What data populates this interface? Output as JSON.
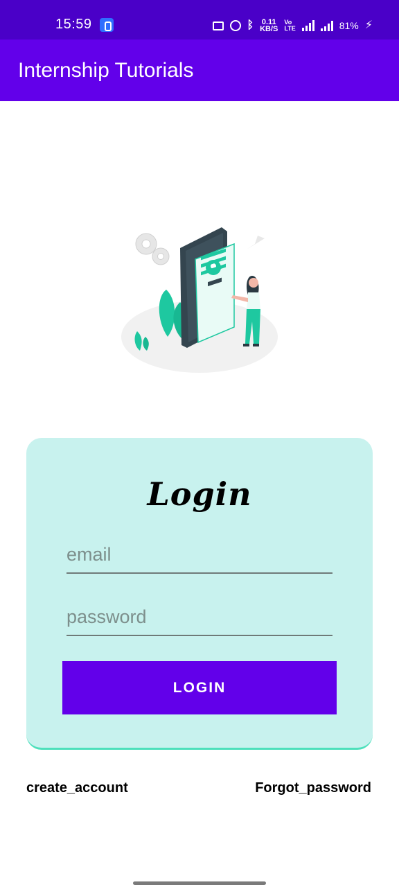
{
  "status_bar": {
    "time": "15:59",
    "network_speed": "0.11\nKB/S",
    "volte": "Vo\nLTE",
    "network_type": "4G",
    "battery": "81%",
    "background_color": "#4a00c8"
  },
  "app_bar": {
    "title": "Internship Tutorials",
    "background_color": "#6200ea"
  },
  "login_card": {
    "heading": "Login",
    "background_color": "#c8f2ee",
    "email_placeholder": "email",
    "password_placeholder": "password",
    "login_button_label": "LOGIN",
    "button_color": "#6200ea"
  },
  "links": {
    "create_account": "create_account",
    "forgot_password": "Forgot_password"
  },
  "icons": {
    "status": [
      "app-notification-icon",
      "message-icon",
      "alarm-icon",
      "bluetooth-icon",
      "signal-icon",
      "charging-icon"
    ],
    "illustration": "phone-login-illustration"
  }
}
